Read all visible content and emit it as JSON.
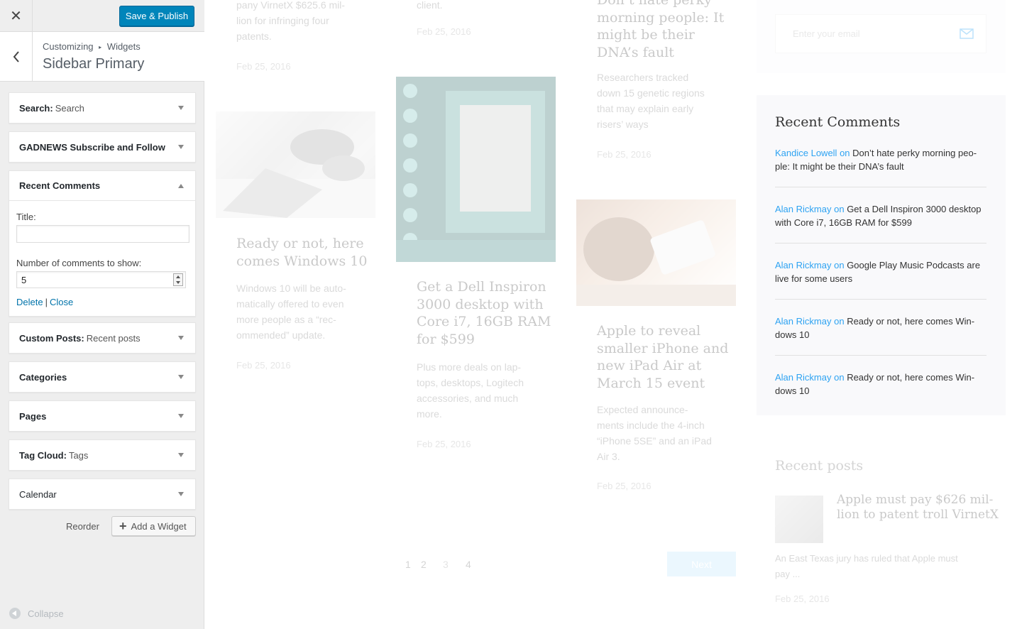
{
  "customizer": {
    "close_label": "✕",
    "publish_label": "Save & Publish",
    "breadcrumb": {
      "root": "Customizing",
      "separator": "▸",
      "current": "Widgets"
    },
    "section_title": "Sidebar Primary",
    "widgets": [
      {
        "name": "Search",
        "subtitle": "Search"
      },
      {
        "name": "GADNEWS Subscribe and Follow",
        "subtitle": ""
      },
      {
        "name": "Recent Comments",
        "subtitle": "",
        "open": true
      },
      {
        "name": "Custom Posts",
        "subtitle": "Recent posts"
      },
      {
        "name": "Categories",
        "subtitle": ""
      },
      {
        "name": "Pages",
        "subtitle": ""
      },
      {
        "name": "Tag Cloud",
        "subtitle": "Tags"
      },
      {
        "name": "Calendar",
        "subtitle": ""
      }
    ],
    "recent_comments_form": {
      "title_label": "Title:",
      "title_value": "",
      "count_label": "Number of comments to show:",
      "count_value": "5",
      "delete_label": "Delete",
      "separator": "|",
      "close_label": "Close"
    },
    "reorder_label": "Reorder",
    "add_widget_label": "Add a Widget",
    "collapse_label": "Collapse"
  },
  "preview": {
    "col1": {
      "top_text": "pany VirnetX $625.6 mil-\nlion for infringing four\npatents.",
      "top_date": "Feb 25, 2016",
      "post_title": "Ready or not, here\ncomes Windows 10",
      "excerpt": "Windows 10 will be auto-\nmatically offered to even\nmore people as a “rec-\nommended” update.",
      "date": "Feb 25, 2016"
    },
    "col2": {
      "top_text": "client.",
      "top_date": "Feb 25, 2016",
      "post_title": "Get a Dell Inspiron\n3000 desktop with\nCore i7, 16GB RAM\nfor $599",
      "excerpt": "Plus more deals on lap-\ntops, desktops, Logitech\naccessories, and much\nmore.",
      "date": "Feb 25, 2016"
    },
    "col3": {
      "top_title": "Don’t hate perky\nmorning people: It\nmight be their\nDNA’s fault",
      "top_text": "Researchers tracked\ndown 15 genetic regions\nthat may explain early\nrisers’ ways",
      "top_date": "Feb 25, 2016",
      "post_title": "Apple to reveal\nsmaller iPhone and\nnew iPad Air at\nMarch 15 event",
      "excerpt": "Expected announce-\nments include the 4-inch\n“iPhone 5SE” and an iPad\nAir 3.",
      "date": "Feb 25, 2016"
    },
    "pagination": {
      "pages": [
        "1",
        "2",
        "3",
        "4"
      ],
      "next": "Next"
    },
    "email_placeholder": "Enter your email",
    "recent_comments": {
      "title": "Recent Comments",
      "items": [
        {
          "author": "Kandice Lowell",
          "on": "on",
          "post": "Don’t hate perky morning peo-\nple: It might be their DNA’s fault"
        },
        {
          "author": "Alan Rickmay",
          "on": "on",
          "post": "Get a Dell Inspiron 3000 desktop\nwith Core i7, 16GB RAM for $599"
        },
        {
          "author": "Alan Rickmay",
          "on": "on",
          "post": "Google Play Music Podcasts are\nlive for some users"
        },
        {
          "author": "Alan Rickmay",
          "on": "on",
          "post": "Ready or not, here comes Win-\ndows 10"
        },
        {
          "author": "Alan Rickmay",
          "on": "on",
          "post": "Ready or not, here comes Win-\ndows 10"
        }
      ]
    },
    "recent_posts": {
      "title": "Recent posts",
      "post_title": "Apple must pay $626 mil-\nlion to patent troll VirnetX",
      "excerpt": "An East Texas jury has ruled that Apple must\npay ...",
      "date": "Feb 25, 2016"
    }
  }
}
